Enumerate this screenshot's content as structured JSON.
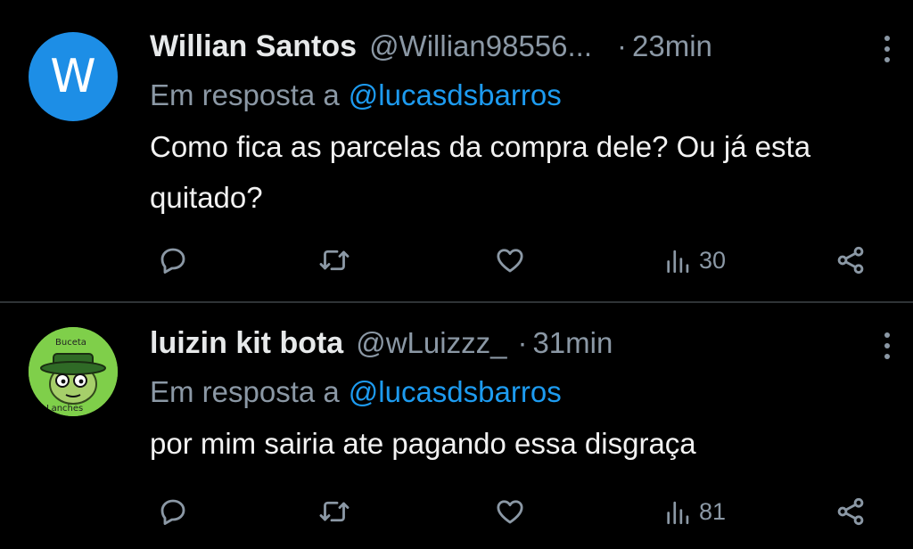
{
  "tweets": [
    {
      "avatar_letter": "W",
      "avatar_color": "#1d8ee6",
      "name": "Willian Santos",
      "handle": "@Willian98556...",
      "separator": "·",
      "time": "23min",
      "reply_prefix": "Em resposta a",
      "reply_to": "@lucasdsbarros",
      "text": "Como fica as parcelas da compra dele? Ou já esta quitado?",
      "views": "30"
    },
    {
      "avatar_text_top": "Buceta",
      "avatar_text_bottom": "Lanches",
      "avatar_color": "#7fcf4a",
      "name": "luizin kit bota",
      "handle": "@wLuizzz_",
      "separator": "·",
      "time": "31min",
      "reply_prefix": "Em resposta a",
      "reply_to": "@lucasdsbarros",
      "text": "por mim sairia ate pagando essa disgraça",
      "views": "81"
    }
  ],
  "colors": {
    "background": "#000000",
    "text": "#e7e9ea",
    "secondary": "#8b98a5",
    "accent": "#1d9bf0",
    "divider": "#2f3336"
  }
}
